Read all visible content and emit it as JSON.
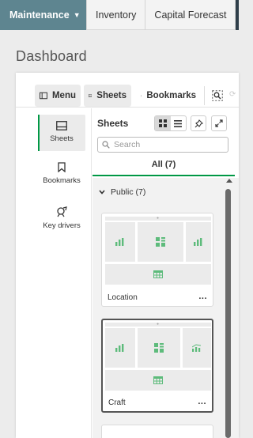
{
  "topnav": {
    "tabs": [
      {
        "label": "Maintenance",
        "active": true
      },
      {
        "label": "Inventory",
        "active": false
      },
      {
        "label": "Capital Forecast",
        "active": false
      }
    ]
  },
  "page": {
    "title": "Dashboard"
  },
  "toolbar": {
    "menu_label": "Menu",
    "sheets_label": "Sheets",
    "bookmarks_label": "Bookmarks"
  },
  "rail": {
    "items": [
      {
        "label": "Sheets",
        "icon": "sheets-icon",
        "active": true
      },
      {
        "label": "Bookmarks",
        "icon": "bookmark-icon",
        "active": false
      },
      {
        "label": "Key drivers",
        "icon": "key-drivers-icon",
        "active": false
      }
    ]
  },
  "sheets_panel": {
    "title": "Sheets",
    "search_placeholder": "Search",
    "tab_all": "All (7)",
    "group_label": "Public (7)",
    "cards": [
      {
        "label": "Location",
        "more": "..."
      },
      {
        "label": "Craft",
        "more": "..."
      }
    ]
  },
  "colors": {
    "accent_green": "#009845",
    "nav_active": "#5e8590",
    "icon_green": "#5dbb7b"
  }
}
